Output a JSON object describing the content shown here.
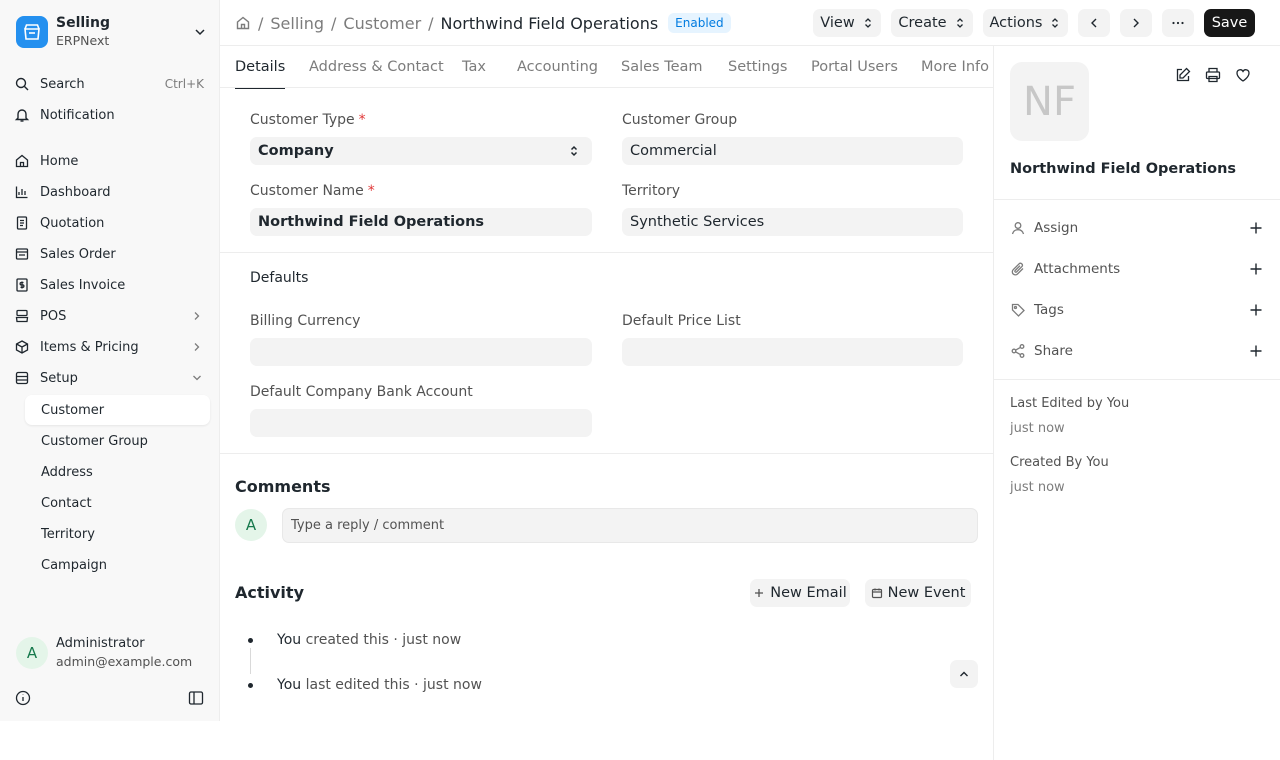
{
  "app": {
    "name": "Selling",
    "sub": "ERPNext"
  },
  "sidebar": {
    "search_label": "Search",
    "search_shortcut": "Ctrl+K",
    "notification_label": "Notification",
    "items": [
      {
        "label": "Home",
        "icon": "home-icon"
      },
      {
        "label": "Dashboard",
        "icon": "chart-icon"
      },
      {
        "label": "Quotation",
        "icon": "document-icon"
      },
      {
        "label": "Sales Order",
        "icon": "cart-icon"
      },
      {
        "label": "Sales Invoice",
        "icon": "invoice-icon"
      },
      {
        "label": "POS",
        "icon": "pos-icon"
      },
      {
        "label": "Items & Pricing",
        "icon": "box-icon"
      },
      {
        "label": "Setup",
        "icon": "setup-icon"
      }
    ],
    "setup_children": [
      "Customer",
      "Customer Group",
      "Address",
      "Contact",
      "Territory",
      "Campaign"
    ]
  },
  "user": {
    "initial": "A",
    "name": "Administrator",
    "email": "admin@example.com"
  },
  "breadcrumb": {
    "module": "Selling",
    "doctype": "Customer",
    "current": "Northwind Field Operations",
    "sep": "/"
  },
  "status_badge": "Enabled",
  "toolbar": {
    "view": "View",
    "create": "Create",
    "actions": "Actions",
    "save": "Save"
  },
  "tabs": [
    "Details",
    "Address & Contact",
    "Tax",
    "Accounting",
    "Sales Team",
    "Settings",
    "Portal Users",
    "More Info"
  ],
  "form": {
    "customer_type": {
      "label": "Customer Type",
      "value": "Company"
    },
    "customer_group": {
      "label": "Customer Group",
      "value": "Commercial"
    },
    "customer_name": {
      "label": "Customer Name",
      "value": "Northwind Field Operations"
    },
    "territory": {
      "label": "Territory",
      "value": "Synthetic Services"
    },
    "required_mark": "*",
    "defaults_title": "Defaults",
    "billing_currency": {
      "label": "Billing Currency",
      "value": ""
    },
    "default_price_list": {
      "label": "Default Price List",
      "value": ""
    },
    "default_bank_account": {
      "label": "Default Company Bank Account",
      "value": ""
    }
  },
  "comments": {
    "title": "Comments",
    "avatar_initial": "A",
    "placeholder": "Type a reply / comment"
  },
  "activity": {
    "title": "Activity",
    "new_email": "New Email",
    "new_event": "New Event",
    "items": [
      {
        "who": "You",
        "text": "created this · just now"
      },
      {
        "who": "You",
        "text": "last edited this · just now"
      }
    ]
  },
  "rpanel": {
    "initials": "NF",
    "title": "Northwind Field Operations",
    "rows": [
      {
        "label": "Assign",
        "icon": "user-icon"
      },
      {
        "label": "Attachments",
        "icon": "paperclip-icon"
      },
      {
        "label": "Tags",
        "icon": "tag-icon"
      },
      {
        "label": "Share",
        "icon": "share-icon"
      }
    ],
    "last_edited_label": "Last Edited by You",
    "last_edited_time": "just now",
    "created_label": "Created By You",
    "created_time": "just now"
  }
}
